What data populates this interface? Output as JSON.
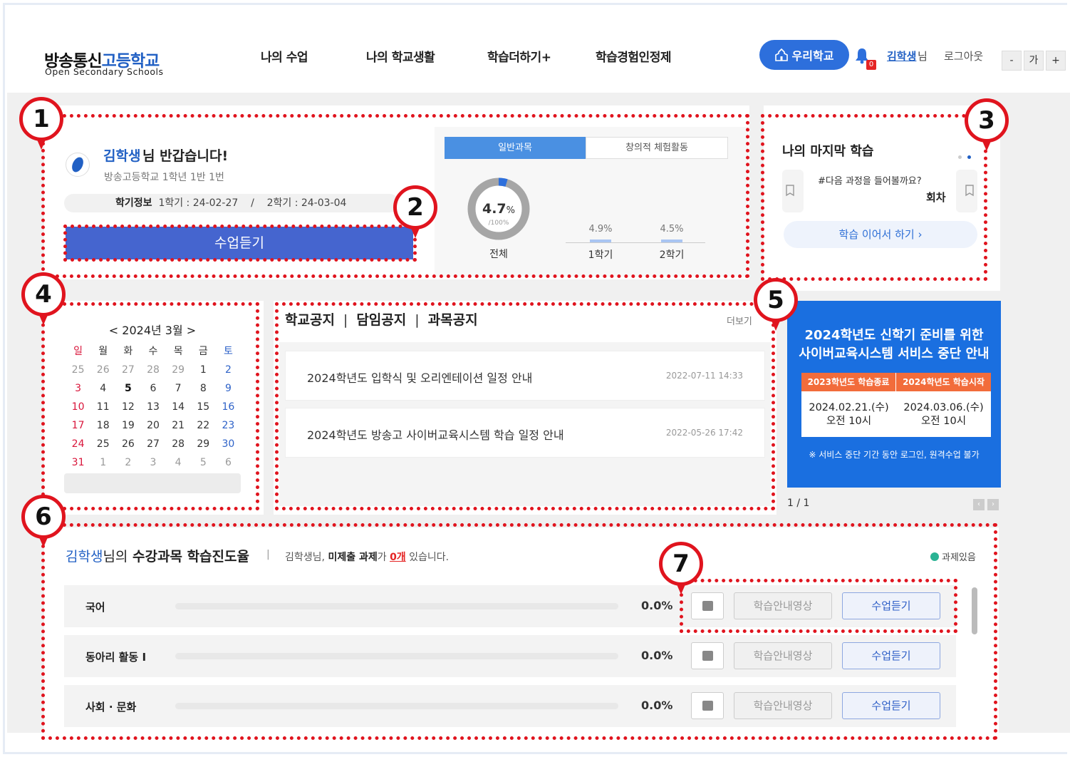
{
  "header": {
    "logo_ko_main": "방송통신",
    "logo_ko_hl": "고등학교",
    "logo_en": "Open Secondary Schools",
    "nav": [
      "나의 수업",
      "나의 학교생활",
      "학습더하기+",
      "학습경험인정제"
    ],
    "my_school": "우리학교",
    "bell_count": "0",
    "user_name": "김학생",
    "user_suffix": "님",
    "logout": "로그아웃",
    "font_minus": "-",
    "font_label": "가",
    "font_plus": "+"
  },
  "markers": [
    "1",
    "2",
    "3",
    "4",
    "5",
    "6",
    "7"
  ],
  "welcome": {
    "name": "김학생",
    "greeting": "님 반갑습니다!",
    "school_info": "방송고등학교 1학년 1반 1번",
    "term_label": "학기정보",
    "term_text": "1학기 : 24-02-27    /    2학기 : 24-03-04",
    "listen_button": "수업듣기"
  },
  "progress_panel": {
    "tab_general": "일반과목",
    "tab_creative": "창의적 체험활동",
    "total_value": "4.7",
    "total_unit": "%",
    "total_sub": "/100%",
    "total_label": "전체",
    "total_fraction": 0.047,
    "sem1_value": "4.9%",
    "sem1_label": "1학기",
    "sem2_value": "4.5%",
    "sem2_label": "2학기"
  },
  "last_study": {
    "title": "나의 마지막 학습",
    "question": "#다음 과정을 들어볼까요?",
    "round": "회차",
    "continue_button": "학습 이어서 하기 ›"
  },
  "calendar": {
    "title": "< 2024년 3월 >",
    "weekdays": [
      "일",
      "월",
      "화",
      "수",
      "목",
      "금",
      "토"
    ],
    "weeks": [
      [
        "25",
        "26",
        "27",
        "28",
        "29",
        "1",
        "2"
      ],
      [
        "3",
        "4",
        "5",
        "6",
        "7",
        "8",
        "9"
      ],
      [
        "10",
        "11",
        "12",
        "13",
        "14",
        "15",
        "16"
      ],
      [
        "17",
        "18",
        "19",
        "20",
        "21",
        "22",
        "23"
      ],
      [
        "24",
        "25",
        "26",
        "27",
        "28",
        "29",
        "30"
      ],
      [
        "31",
        "1",
        "2",
        "3",
        "4",
        "5",
        "6"
      ]
    ]
  },
  "notices": {
    "tab_school": "학교공지",
    "tab_homeroom": "담임공지",
    "tab_subject": "과목공지",
    "more": "더보기",
    "items": [
      {
        "title": "2024학년도 입학식 및 오리엔테이션 일정 안내",
        "date": "2022-07-11 14:33"
      },
      {
        "title": "2024학년도 방송고 사이버교육시스템 학습 일정 안내",
        "date": "2022-05-26 17:42"
      }
    ]
  },
  "banner": {
    "heading_line1": "2024학년도 신학기 준비를 위한",
    "heading_line2": "사이버교육시스템 서비스 중단 안내",
    "col1_head": "2023학년도 학습종료",
    "col2_head": "2024학년도 학습시작",
    "col1_date": "2024.02.21.(수)",
    "col1_time": "오전 10시",
    "col2_date": "2024.03.06.(수)",
    "col2_time": "오전 10시",
    "note": "※ 서비스 중단 기간 동안 로그인, 원격수업 불가",
    "page": "1 / 1",
    "prev": "‹",
    "next": "›"
  },
  "course_progress": {
    "title_name": "김학생",
    "title_suffix": "님의",
    "title_main": "수강과목 학습진도율",
    "divider": "|",
    "msg_pre": "김학생님,",
    "msg_bold": "미제출 과제",
    "msg_mid": "가",
    "msg_count": "0개",
    "msg_post": "있습니다.",
    "legend": "과제있음",
    "guide_button": "학습안내영상",
    "listen_button": "수업듣기",
    "rows": [
      {
        "name": "국어",
        "pct": "0.0%",
        "fraction": 0.0
      },
      {
        "name": "동아리 활동 I",
        "pct": "0.0%",
        "fraction": 0.0
      },
      {
        "name": "사회 · 문화",
        "pct": "0.0%",
        "fraction": 0.0
      }
    ]
  },
  "colors": {
    "accent": "#2160c4",
    "marker_red": "#e0141e",
    "button_blue": "#4565cf",
    "banner_blue": "#1a6fe0"
  }
}
